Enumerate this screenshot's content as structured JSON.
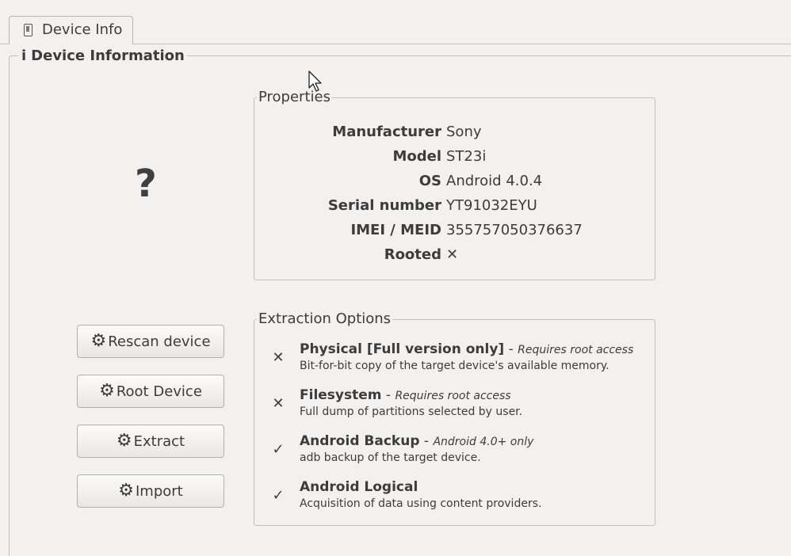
{
  "tab": {
    "label": "Device Info"
  },
  "group": {
    "icon": "info-icon",
    "glyph": "i",
    "title": "Device Information"
  },
  "device_image": {
    "placeholder": "?"
  },
  "properties": {
    "title": "Properties",
    "rows": [
      {
        "key": "Manufacturer",
        "value": "Sony"
      },
      {
        "key": "Model",
        "value": "ST23i"
      },
      {
        "key": "OS",
        "value": "Android 4.0.4"
      },
      {
        "key": "Serial number",
        "value": "YT91032EYU"
      },
      {
        "key": "IMEI / MEID",
        "value": "355757050376637"
      },
      {
        "key": "Rooted",
        "value": "✕"
      }
    ]
  },
  "buttons": [
    {
      "label": "Rescan device",
      "icon": "gear-icon"
    },
    {
      "label": "Root Device",
      "icon": "gear-icon"
    },
    {
      "label": "Extract",
      "icon": "gear-icon"
    },
    {
      "label": "Import",
      "icon": "gear-icon"
    }
  ],
  "extraction": {
    "title": "Extraction Options",
    "options": [
      {
        "mark": "✕",
        "title": "Physical [Full version only]",
        "separator": " - ",
        "note": "Requires root access",
        "desc": "Bit-for-bit copy of the target device's available memory."
      },
      {
        "mark": "✕",
        "title": "Filesystem",
        "separator": " - ",
        "note": "Requires root access",
        "desc": "Full dump of partitions selected by user."
      },
      {
        "mark": "✓",
        "title": "Android Backup",
        "separator": " - ",
        "note": "Android 4.0+ only",
        "desc": "adb backup of the target device."
      },
      {
        "mark": "✓",
        "title": "Android Logical",
        "separator": "",
        "note": "",
        "desc": "Acquisition of data using content providers."
      }
    ]
  }
}
